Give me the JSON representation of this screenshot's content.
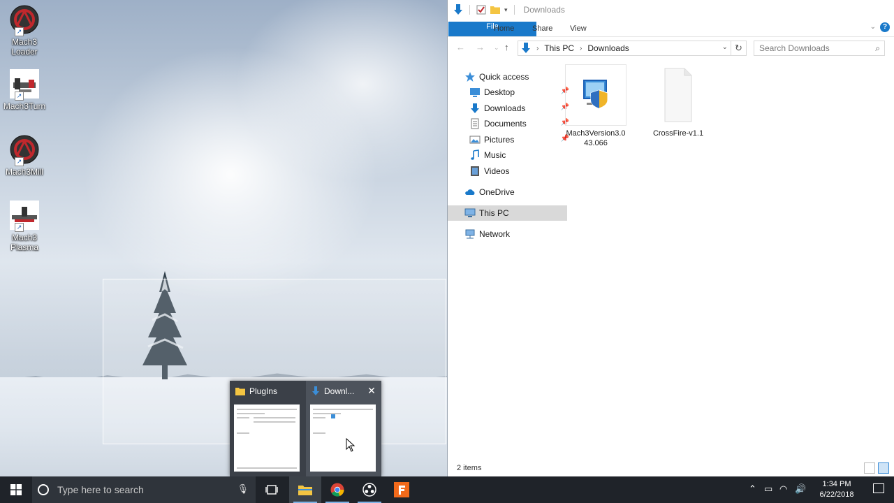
{
  "desktop": {
    "icons": [
      {
        "label": "Mach3\nLoader",
        "icon": "mach3-logo-icon"
      },
      {
        "label": "Mach3Turn",
        "icon": "lathe-icon"
      },
      {
        "label": "Mach3Mill",
        "icon": "mach3-logo-icon"
      },
      {
        "label": "Mach3\nPlasma",
        "icon": "plasma-cutter-icon"
      }
    ]
  },
  "thumbnails": {
    "items": [
      {
        "title": "PlugIns",
        "icon": "folder-icon"
      },
      {
        "title": "Downl...",
        "icon": "downloads-icon"
      }
    ],
    "close_glyph": "✕"
  },
  "explorer": {
    "title": "Downloads",
    "ribbon_tabs": [
      "File",
      "Home",
      "Share",
      "View"
    ],
    "help_glyph": "?",
    "address": [
      "This PC",
      "Downloads"
    ],
    "search_placeholder": "Search Downloads",
    "nav": {
      "quick_access": "Quick access",
      "pinned": [
        "Desktop",
        "Downloads",
        "Documents",
        "Pictures"
      ],
      "unpinned": [
        "Music",
        "Videos"
      ],
      "onedrive": "OneDrive",
      "this_pc": "This PC",
      "network": "Network"
    },
    "files": [
      {
        "name": "Mach3Version3.0\n43.066",
        "icon": "installer-icon"
      },
      {
        "name": "CrossFire-v1.1",
        "icon": "blank-file-icon"
      }
    ],
    "status": "2 items"
  },
  "taskbar": {
    "search_placeholder": "Type here to search",
    "time": "1:34 PM",
    "date": "6/22/2018",
    "apps": [
      "task-view-icon",
      "file-explorer-icon",
      "chrome-icon",
      "obs-icon",
      "fusion-icon"
    ]
  },
  "colors": {
    "accent": "#1979ca",
    "taskbar": "#1f2329",
    "selection": "#d9d9d9"
  }
}
